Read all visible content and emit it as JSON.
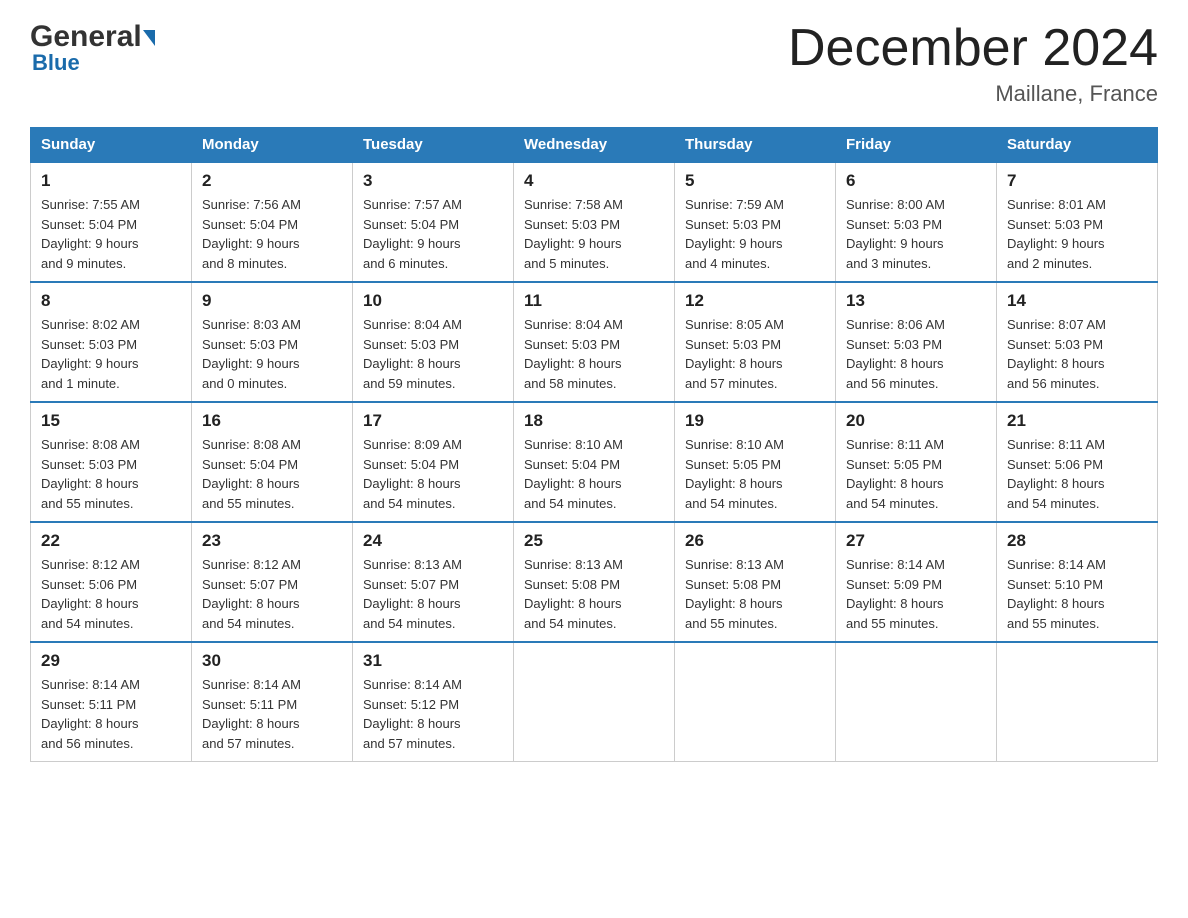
{
  "logo": {
    "general": "General",
    "blue": "Blue"
  },
  "header": {
    "title": "December 2024",
    "location": "Maillane, France"
  },
  "days_of_week": [
    "Sunday",
    "Monday",
    "Tuesday",
    "Wednesday",
    "Thursday",
    "Friday",
    "Saturday"
  ],
  "weeks": [
    [
      {
        "day": "1",
        "sunrise": "7:55 AM",
        "sunset": "5:04 PM",
        "daylight": "9 hours and 9 minutes."
      },
      {
        "day": "2",
        "sunrise": "7:56 AM",
        "sunset": "5:04 PM",
        "daylight": "9 hours and 8 minutes."
      },
      {
        "day": "3",
        "sunrise": "7:57 AM",
        "sunset": "5:04 PM",
        "daylight": "9 hours and 6 minutes."
      },
      {
        "day": "4",
        "sunrise": "7:58 AM",
        "sunset": "5:03 PM",
        "daylight": "9 hours and 5 minutes."
      },
      {
        "day": "5",
        "sunrise": "7:59 AM",
        "sunset": "5:03 PM",
        "daylight": "9 hours and 4 minutes."
      },
      {
        "day": "6",
        "sunrise": "8:00 AM",
        "sunset": "5:03 PM",
        "daylight": "9 hours and 3 minutes."
      },
      {
        "day": "7",
        "sunrise": "8:01 AM",
        "sunset": "5:03 PM",
        "daylight": "9 hours and 2 minutes."
      }
    ],
    [
      {
        "day": "8",
        "sunrise": "8:02 AM",
        "sunset": "5:03 PM",
        "daylight": "9 hours and 1 minute."
      },
      {
        "day": "9",
        "sunrise": "8:03 AM",
        "sunset": "5:03 PM",
        "daylight": "9 hours and 0 minutes."
      },
      {
        "day": "10",
        "sunrise": "8:04 AM",
        "sunset": "5:03 PM",
        "daylight": "8 hours and 59 minutes."
      },
      {
        "day": "11",
        "sunrise": "8:04 AM",
        "sunset": "5:03 PM",
        "daylight": "8 hours and 58 minutes."
      },
      {
        "day": "12",
        "sunrise": "8:05 AM",
        "sunset": "5:03 PM",
        "daylight": "8 hours and 57 minutes."
      },
      {
        "day": "13",
        "sunrise": "8:06 AM",
        "sunset": "5:03 PM",
        "daylight": "8 hours and 56 minutes."
      },
      {
        "day": "14",
        "sunrise": "8:07 AM",
        "sunset": "5:03 PM",
        "daylight": "8 hours and 56 minutes."
      }
    ],
    [
      {
        "day": "15",
        "sunrise": "8:08 AM",
        "sunset": "5:03 PM",
        "daylight": "8 hours and 55 minutes."
      },
      {
        "day": "16",
        "sunrise": "8:08 AM",
        "sunset": "5:04 PM",
        "daylight": "8 hours and 55 minutes."
      },
      {
        "day": "17",
        "sunrise": "8:09 AM",
        "sunset": "5:04 PM",
        "daylight": "8 hours and 54 minutes."
      },
      {
        "day": "18",
        "sunrise": "8:10 AM",
        "sunset": "5:04 PM",
        "daylight": "8 hours and 54 minutes."
      },
      {
        "day": "19",
        "sunrise": "8:10 AM",
        "sunset": "5:05 PM",
        "daylight": "8 hours and 54 minutes."
      },
      {
        "day": "20",
        "sunrise": "8:11 AM",
        "sunset": "5:05 PM",
        "daylight": "8 hours and 54 minutes."
      },
      {
        "day": "21",
        "sunrise": "8:11 AM",
        "sunset": "5:06 PM",
        "daylight": "8 hours and 54 minutes."
      }
    ],
    [
      {
        "day": "22",
        "sunrise": "8:12 AM",
        "sunset": "5:06 PM",
        "daylight": "8 hours and 54 minutes."
      },
      {
        "day": "23",
        "sunrise": "8:12 AM",
        "sunset": "5:07 PM",
        "daylight": "8 hours and 54 minutes."
      },
      {
        "day": "24",
        "sunrise": "8:13 AM",
        "sunset": "5:07 PM",
        "daylight": "8 hours and 54 minutes."
      },
      {
        "day": "25",
        "sunrise": "8:13 AM",
        "sunset": "5:08 PM",
        "daylight": "8 hours and 54 minutes."
      },
      {
        "day": "26",
        "sunrise": "8:13 AM",
        "sunset": "5:08 PM",
        "daylight": "8 hours and 55 minutes."
      },
      {
        "day": "27",
        "sunrise": "8:14 AM",
        "sunset": "5:09 PM",
        "daylight": "8 hours and 55 minutes."
      },
      {
        "day": "28",
        "sunrise": "8:14 AM",
        "sunset": "5:10 PM",
        "daylight": "8 hours and 55 minutes."
      }
    ],
    [
      {
        "day": "29",
        "sunrise": "8:14 AM",
        "sunset": "5:11 PM",
        "daylight": "8 hours and 56 minutes."
      },
      {
        "day": "30",
        "sunrise": "8:14 AM",
        "sunset": "5:11 PM",
        "daylight": "8 hours and 57 minutes."
      },
      {
        "day": "31",
        "sunrise": "8:14 AM",
        "sunset": "5:12 PM",
        "daylight": "8 hours and 57 minutes."
      },
      null,
      null,
      null,
      null
    ]
  ],
  "labels": {
    "sunrise": "Sunrise:",
    "sunset": "Sunset:",
    "daylight": "Daylight:"
  }
}
